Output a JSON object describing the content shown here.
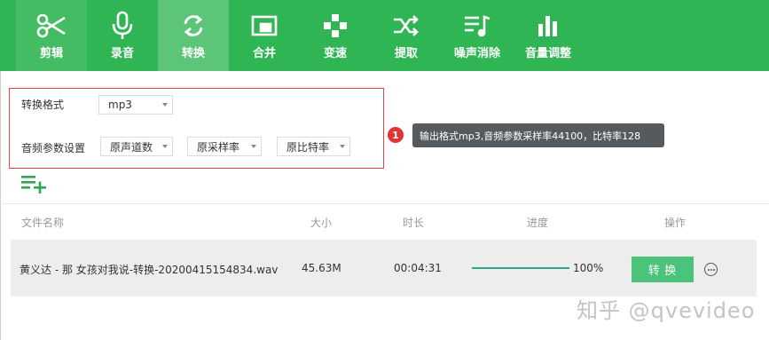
{
  "toolbar": {
    "items": [
      {
        "label": "剪辑",
        "icon": "scissors-icon"
      },
      {
        "label": "录音",
        "icon": "microphone-icon"
      },
      {
        "label": "转换",
        "icon": "refresh-icon"
      },
      {
        "label": "合并",
        "icon": "merge-icon"
      },
      {
        "label": "变速",
        "icon": "speed-icon"
      },
      {
        "label": "提取",
        "icon": "shuffle-icon"
      },
      {
        "label": "噪声消除",
        "icon": "music-list-icon"
      },
      {
        "label": "音量调整",
        "icon": "bar-chart-icon"
      }
    ],
    "active_index": 2,
    "background": "#2fb553"
  },
  "settings": {
    "format_label": "转换格式",
    "format_value": "mp3",
    "audio_label": "音频参数设置",
    "channels_value": "原声道数",
    "samplerate_value": "原采样率",
    "bitrate_value": "原比特率"
  },
  "annotation": {
    "badge": "1",
    "text": "输出格式mp3,音频参数采样率44100，比特率128"
  },
  "table": {
    "headers": {
      "name": "文件名称",
      "size": "大小",
      "duration": "时长",
      "progress": "进度",
      "action": "操作"
    },
    "rows": [
      {
        "name": "黄义达 - 那 女孩对我说-转换-20200415154834.wav",
        "size": "45.63M",
        "duration": "00:04:31",
        "progress": "100%",
        "progress_fraction": 1.0,
        "button": "转 换"
      }
    ]
  },
  "watermark": "知乎 @qvevideo"
}
